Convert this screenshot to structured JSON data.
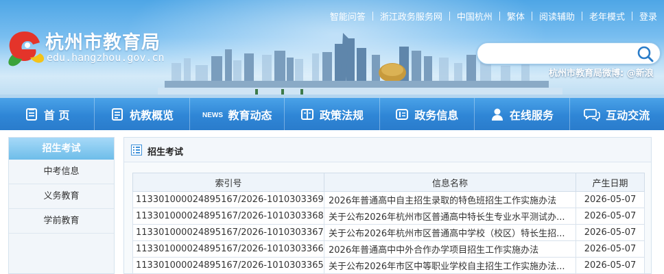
{
  "site": {
    "title": "杭州市教育局",
    "url": "edu.hangzhou.gov.cn",
    "weibo": "杭州市教育局微博: @新浪"
  },
  "top_links": [
    "智能问答",
    "浙江政务服务网",
    "中国杭州",
    "繁体",
    "阅读辅助",
    "老年模式",
    "登录"
  ],
  "search": {
    "placeholder": ""
  },
  "nav": [
    {
      "label": "首 页",
      "icon": "home-icon"
    },
    {
      "label": "杭教概览",
      "icon": "document-icon"
    },
    {
      "label": "教育动态",
      "icon": "news-icon"
    },
    {
      "label": "政策法规",
      "icon": "book-icon"
    },
    {
      "label": "政务信息",
      "icon": "info-icon"
    },
    {
      "label": "在线服务",
      "icon": "person-icon"
    },
    {
      "label": "互动交流",
      "icon": "chat-icon"
    }
  ],
  "sidebar": {
    "active": "招生考试",
    "items": [
      "中考信息",
      "义务教育",
      "学前教育"
    ]
  },
  "main": {
    "title": "招生考试",
    "columns": [
      "索引号",
      "信息名称",
      "产生日期"
    ],
    "rows": [
      {
        "index": "113301000024895167/2026-1010303369",
        "name": "2026年普通高中自主招生录取的特色班招生工作实施办法",
        "date": "2026-05-07"
      },
      {
        "index": "113301000024895167/2026-1010303368",
        "name": "关于公布2026年杭州市区普通高中特长生专业水平测试办...",
        "date": "2026-05-07"
      },
      {
        "index": "113301000024895167/2026-1010303367",
        "name": "关于公布2026年杭州市区普通高中学校（校区）特长生招...",
        "date": "2026-05-07"
      },
      {
        "index": "113301000024895167/2026-1010303366",
        "name": "2026年普通高中中外合作办学项目招生工作实施办法",
        "date": "2026-05-07"
      },
      {
        "index": "113301000024895167/2026-1010303365",
        "name": "关于公布2026年市区中等职业学校自主招生工作实施办法...",
        "date": "2026-05-07"
      }
    ]
  },
  "colors": {
    "nav_bg": "#2f86d6",
    "sky_top": "#4ea6e6",
    "sidebar_active": "#6ebde9",
    "logo_red": "#e4342a",
    "logo_green": "#3ca23a",
    "logo_yellow": "#f3c319"
  }
}
